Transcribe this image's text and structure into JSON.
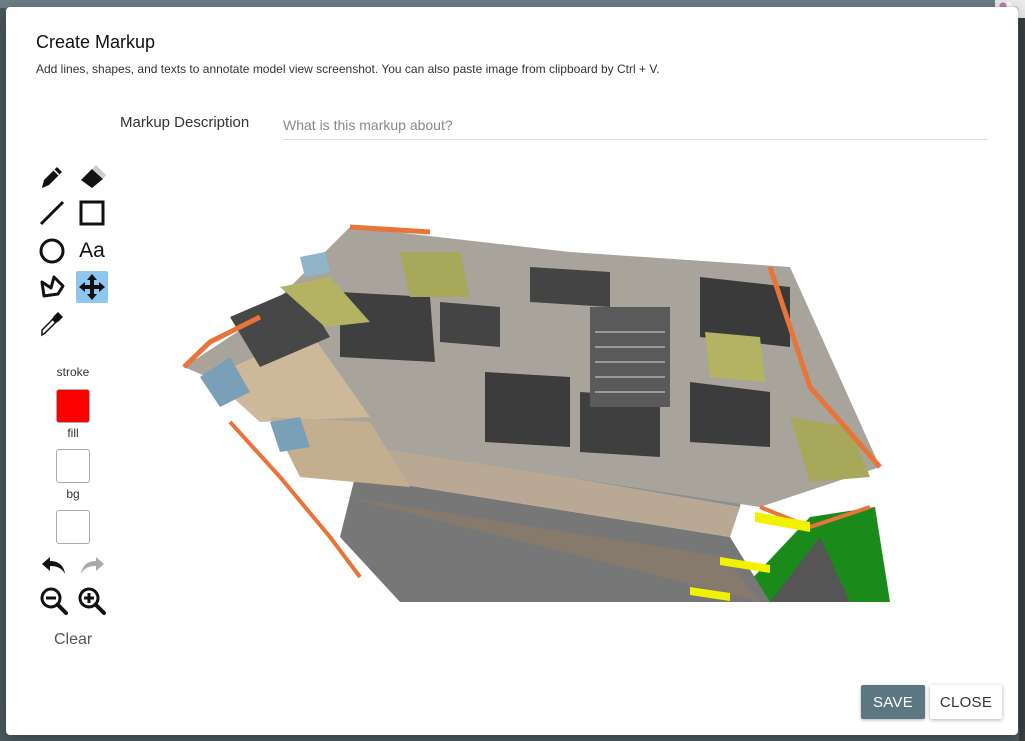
{
  "dialog": {
    "title": "Create Markup",
    "subtitle": "Add lines, shapes, and texts to annotate model view screenshot. You can also paste image from clipboard by Ctrl + V."
  },
  "description": {
    "label": "Markup Description",
    "placeholder": "What is this markup about?",
    "value": ""
  },
  "tools": [
    {
      "name": "pencil-icon"
    },
    {
      "name": "eraser-icon"
    },
    {
      "name": "line-icon"
    },
    {
      "name": "rectangle-icon"
    },
    {
      "name": "circle-icon"
    },
    {
      "name": "text-tool",
      "label": "Aa"
    },
    {
      "name": "polygon-icon"
    },
    {
      "name": "move-icon",
      "active": true
    },
    {
      "name": "eyedropper-icon"
    }
  ],
  "colors": {
    "stroke_label": "stroke",
    "stroke": "#ff0000",
    "fill_label": "fill",
    "fill": "#ffffff",
    "bg_label": "bg",
    "bg": "#ffffff",
    "active_tool": "#8ec6ef",
    "save_button": "#5c7682"
  },
  "actions": {
    "clear_label": "Clear",
    "save_label": "SAVE",
    "close_label": "CLOSE"
  }
}
